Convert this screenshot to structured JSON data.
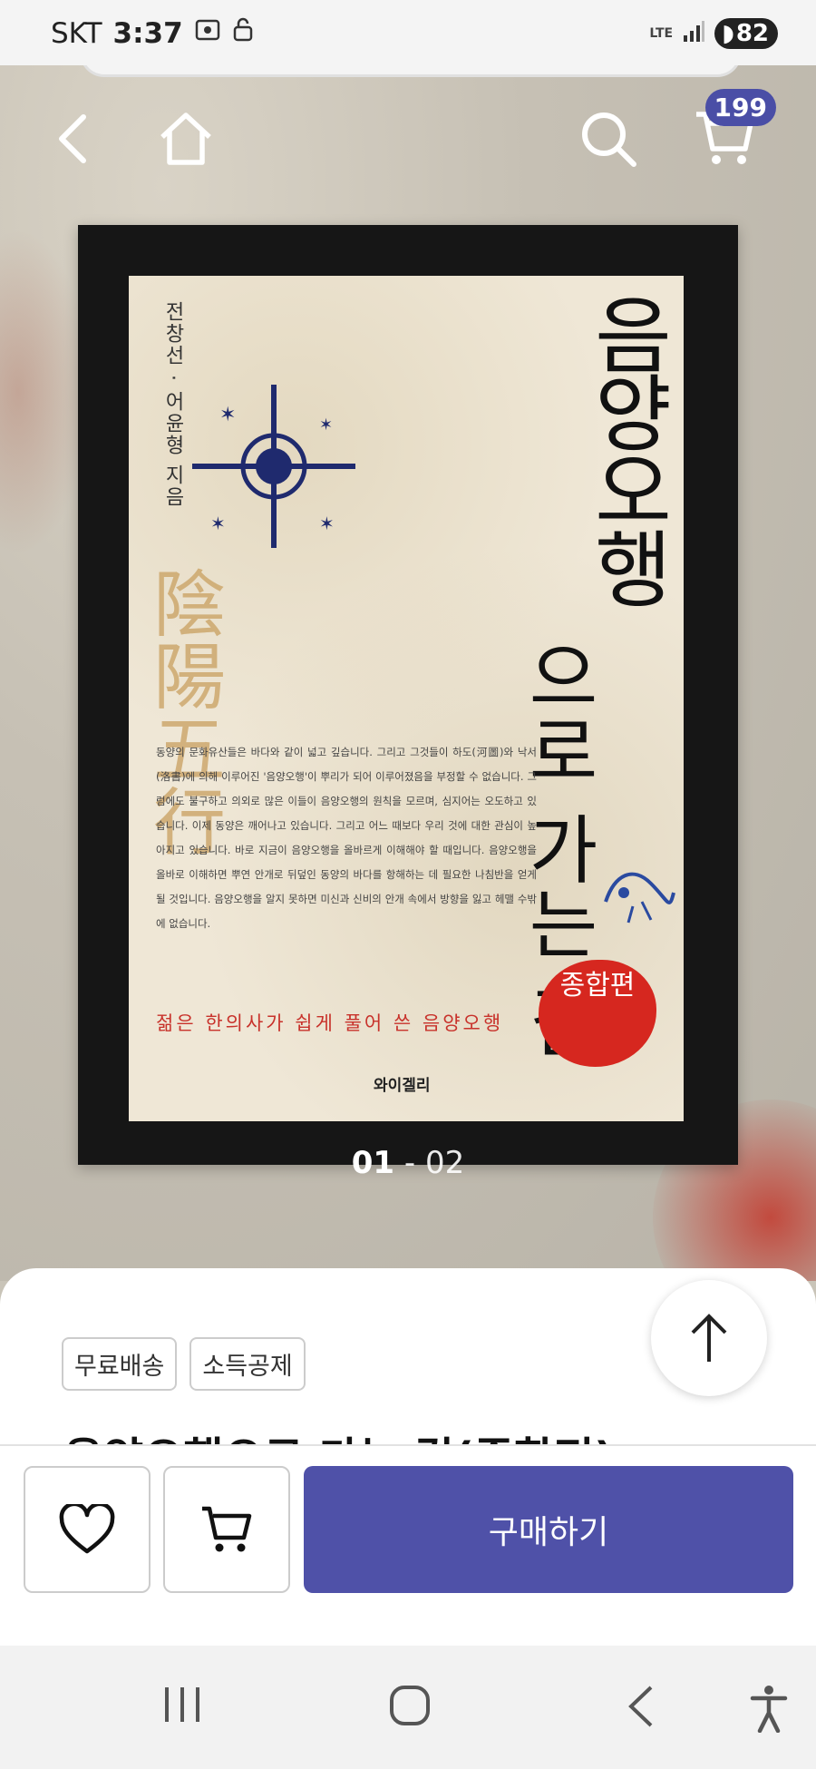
{
  "status_bar": {
    "carrier": "SKT",
    "time": "3:37",
    "network": "LTE",
    "battery": "82"
  },
  "nav": {
    "back_icon": "chevron-left-icon",
    "home_icon": "home-icon",
    "search_icon": "search-icon",
    "cart_icon": "cart-icon",
    "cart_count": "199"
  },
  "book_cover": {
    "title": "음양오행",
    "subtitle": "으로 가는 길",
    "authors": "전창선 · 어윤형 지음",
    "hanja": "陰陽五行",
    "blurb": "동양의 문화유산들은 바다와 같이 넓고 깊습니다. 그리고 그것들이 하도(河圖)와 낙서(洛書)에 의해 이루어진 '음양오행'이 뿌리가 되어 이루어졌음을 부정할 수 없습니다. 그럼에도 불구하고 의외로 많은 이들이 음양오행의 원칙을 모르며, 심지어는 오도하고 있습니다. 이제 동양은 깨어나고 있습니다. 그리고 어느 때보다 우리 것에 대한 관심이 높아지고 있습니다. 바로 지금이 음양오행을 올바르게 이해해야 할 때입니다. 음양오행을 올바로 이해하면 뿌연 안개로 뒤덮인 동양의 바다를 항해하는 데 필요한 나침반을 얻게 될 것입니다. 음양오행을 알지 못하면 미신과 신비의 안개 속에서 방향을 잃고 헤맬 수밖에 없습니다.",
    "tagline": "젊은 한의사가 쉽게 풀어 쓴 음양오행",
    "seal": "종합편",
    "publisher": "와이겔리"
  },
  "pager": {
    "current": "01",
    "separator": "-",
    "total": "02"
  },
  "sheet": {
    "tags": [
      "무료배송",
      "소득공제"
    ],
    "title_peek": "음양오행으로 가는 길(종합편)"
  },
  "actions": {
    "wishlist_icon": "heart-icon",
    "cart_icon": "cart-icon",
    "buy_label": "구매하기"
  },
  "colors": {
    "accent": "#4f51a8",
    "badge": "#4a4ea6",
    "seal_red": "#d6271f"
  }
}
